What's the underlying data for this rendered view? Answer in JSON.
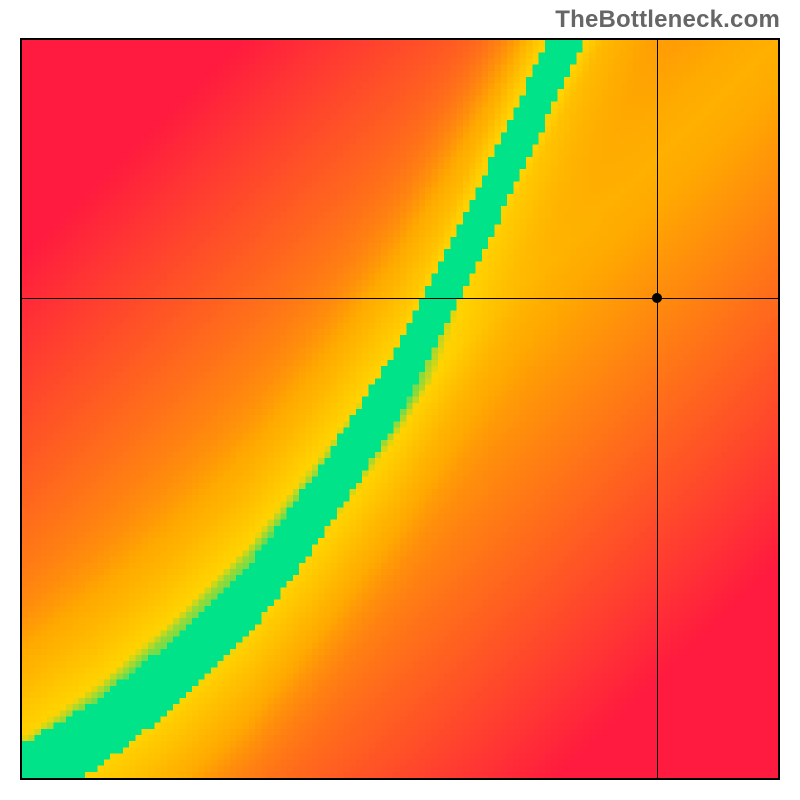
{
  "watermark": "TheBottleneck.com",
  "chart_data": {
    "type": "heatmap",
    "title": "",
    "xlabel": "",
    "ylabel": "",
    "xlim": [
      0,
      1
    ],
    "ylim": [
      0,
      1
    ],
    "marker": {
      "x": 0.84,
      "y": 0.65
    },
    "optimal_curve": {
      "description": "Green ridge of near-zero bottleneck running diagonally; points are (x, y) fractions of plot area from bottom-left.",
      "points": [
        [
          0.0,
          0.0
        ],
        [
          0.1,
          0.06
        ],
        [
          0.2,
          0.14
        ],
        [
          0.3,
          0.24
        ],
        [
          0.4,
          0.38
        ],
        [
          0.5,
          0.54
        ],
        [
          0.58,
          0.7
        ],
        [
          0.65,
          0.85
        ],
        [
          0.72,
          1.0
        ]
      ]
    },
    "color_scale": {
      "low_match": "#ff1a40",
      "mid": "#ffd400",
      "high_match": "#00e388"
    },
    "grid": false,
    "legend": false
  }
}
